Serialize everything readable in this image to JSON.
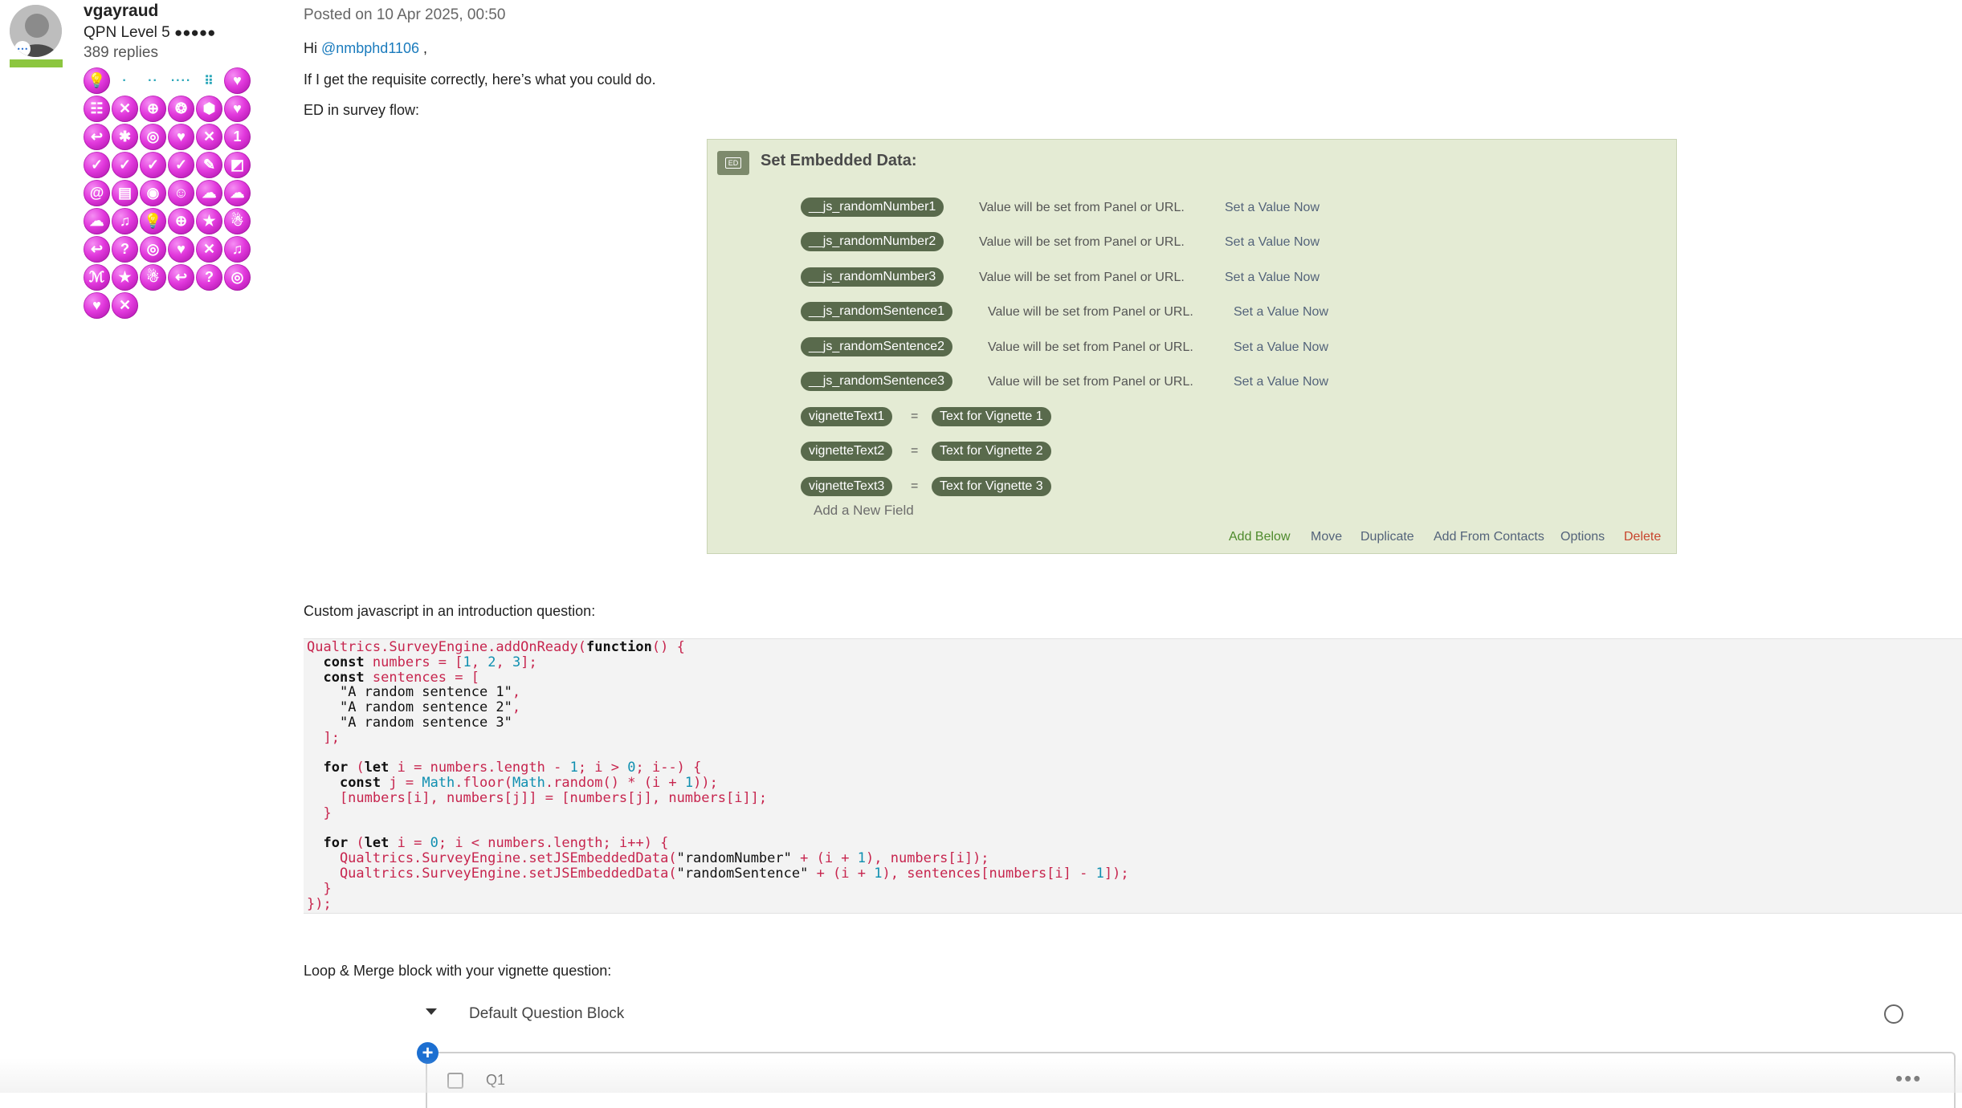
{
  "author": {
    "name": "vgayraud",
    "level": "QPN Level 5",
    "level_dots": "●●●●●",
    "replies": "389 replies",
    "badges": [
      "💡",
      "·",
      "··",
      "····",
      "⠿",
      "♥",
      "☷",
      "✕",
      "⊕",
      "❂",
      "⬢",
      "♥",
      "↩",
      "✱",
      "◎",
      "♥",
      "✕",
      "1",
      "✓",
      "✓",
      "✓",
      "✓",
      "✎",
      "◩",
      "@",
      "▤",
      "◉",
      "☺",
      "☁",
      "☁",
      "☁",
      "♫",
      "💡",
      "⊕",
      "★",
      "☃",
      "↩",
      "?",
      "◎",
      "♥",
      "✕",
      "♫",
      "ℳ",
      "★",
      "☃",
      "↩",
      "?",
      "◎",
      "♥",
      "✕"
    ]
  },
  "post": {
    "posted": "Posted on 10 Apr 2025, 00:50",
    "greeting_prefix": "Hi ",
    "mention": "@nmbphd1106",
    "greeting_suffix": " ,",
    "line2": "If I get the requisite correctly, here’s what you could do.",
    "line3": "ED in survey flow:",
    "line4": "Custom javascript in an introduction question:",
    "line5": "Loop & Merge block with your vignette question:"
  },
  "embedded_data": {
    "icon": "ED",
    "title": "Set Embedded Data:",
    "note": "Value will be set from Panel or URL.",
    "set_link": "Set a Value Now",
    "fields": [
      "__js_randomNumber1",
      "__js_randomNumber2",
      "__js_randomNumber3",
      "__js_randomSentence1",
      "__js_randomSentence2",
      "__js_randomSentence3"
    ],
    "eq": "=",
    "assignments": [
      {
        "name": "vignetteText1",
        "value": "Text for Vignette 1"
      },
      {
        "name": "vignetteText2",
        "value": "Text for Vignette 2"
      },
      {
        "name": "vignetteText3",
        "value": "Text for Vignette 3"
      }
    ],
    "add_field": "Add a New Field",
    "actions": [
      "Add Below",
      "Move",
      "Duplicate",
      "Add From Contacts",
      "Options",
      "Delete"
    ]
  },
  "code_lines": [
    "Qualtrics.SurveyEngine.addOnReady(function() {",
    "  const numbers = [1, 2, 3];",
    "  const sentences = [",
    "    \"A random sentence 1\",",
    "    \"A random sentence 2\",",
    "    \"A random sentence 3\"",
    "  ];",
    "",
    "  for (let i = numbers.length - 1; i > 0; i--) {",
    "    const j = Math.floor(Math.random() * (i + 1));",
    "    [numbers[i], numbers[j]] = [numbers[j], numbers[i]];",
    "  }",
    "",
    "  for (let i = 0; i < numbers.length; i++) {",
    "    Qualtrics.SurveyEngine.setJSEmbeddedData(\"randomNumber\" + (i + 1), numbers[i]);",
    "    Qualtrics.SurveyEngine.setJSEmbeddedData(\"randomSentence\" + (i + 1), sentences[numbers[i] - 1]);",
    "  }",
    "});"
  ],
  "question_block": {
    "title": "Default Question Block",
    "add": "+",
    "question": "Q1",
    "more": "•••"
  }
}
